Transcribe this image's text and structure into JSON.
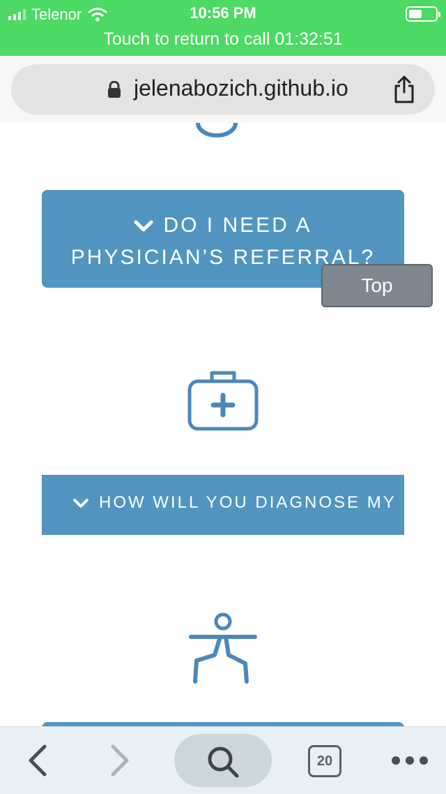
{
  "status_bar": {
    "carrier": "Telenor",
    "time": "10:56 PM",
    "call_banner": "Touch to return to call 01:32:51"
  },
  "browser": {
    "url": "jelenabozich.github.io",
    "tab_count": "20"
  },
  "page": {
    "faq_1_line1": "DO I NEED A",
    "faq_1_line2": "PHYSICIAN’S REFERRAL?",
    "faq_2": "HOW WILL YOU DIAGNOSE MY",
    "top_button": "Top"
  },
  "colors": {
    "status_green": "#4cd964",
    "accent_blue": "#5195c0",
    "top_button_gray": "#7f8790"
  },
  "icons": [
    "signal-icon",
    "wifi-icon",
    "battery-icon",
    "lock-icon",
    "share-icon",
    "chevron-down-icon",
    "medkit-icon",
    "yoga-pose-icon",
    "back-icon",
    "forward-icon",
    "search-icon",
    "tabs-icon",
    "more-icon"
  ]
}
